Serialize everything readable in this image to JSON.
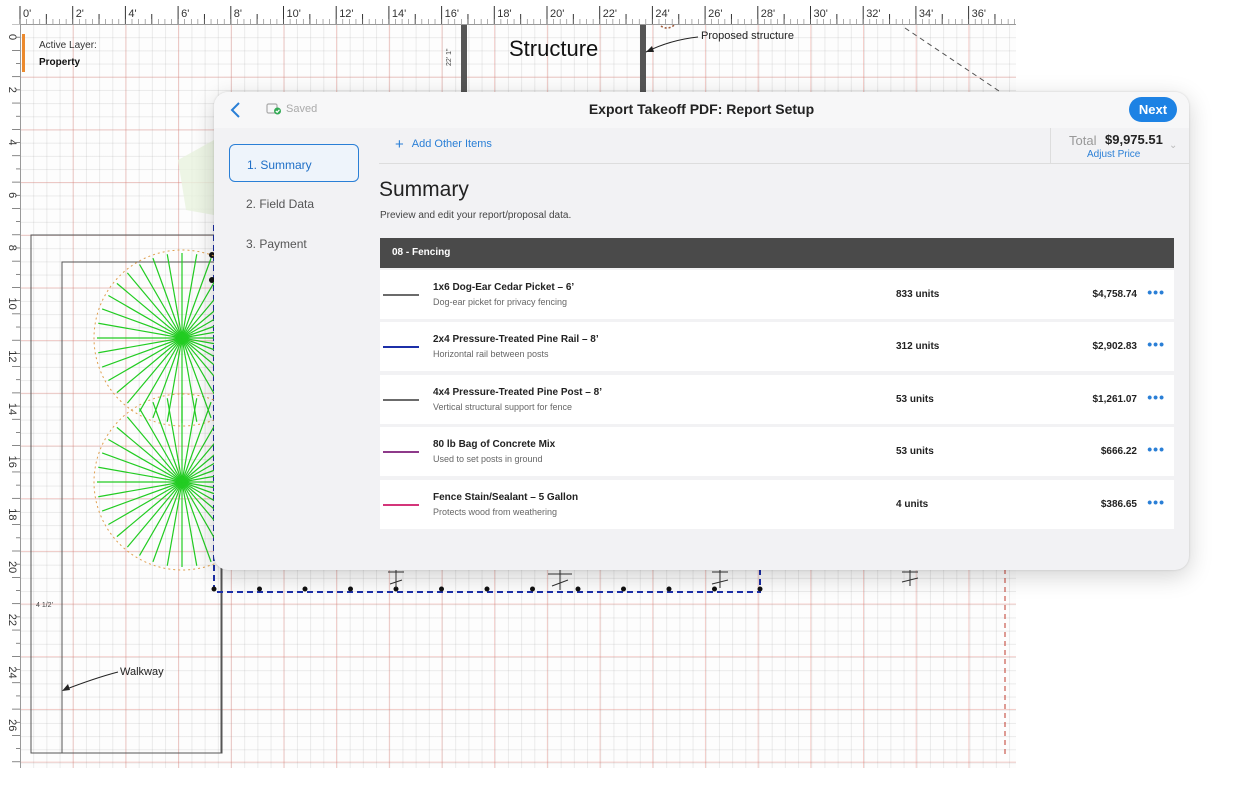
{
  "ruler": {
    "top_labels": [
      "0'",
      "2'",
      "4'",
      "6'",
      "8'",
      "10'",
      "12'",
      "14'",
      "16'",
      "18'",
      "20'",
      "22'",
      "24'",
      "26'",
      "28'",
      "30'",
      "32'",
      "34'",
      "36'"
    ],
    "left_labels": [
      "0",
      "2",
      "4",
      "6",
      "8",
      "10",
      "12",
      "14",
      "16",
      "18",
      "20",
      "22",
      "24",
      "26"
    ]
  },
  "layer": {
    "label": "Active Layer:",
    "value": "Property"
  },
  "canvas": {
    "structure_label": "Structure",
    "proposed_label": "Proposed structure",
    "walkway_label": "Walkway",
    "dimension_label": "4 1/2'"
  },
  "header": {
    "title": "Export Takeoff PDF: Report Setup",
    "saved": "Saved",
    "next": "Next"
  },
  "steps": [
    {
      "label": "1. Summary",
      "active": true
    },
    {
      "label": "2. Field Data",
      "active": false
    },
    {
      "label": "3. Payment",
      "active": false
    }
  ],
  "toolbar": {
    "add_other": "Add Other Items",
    "total_label": "Total",
    "total_value": "$9,975.51",
    "adjust_price": "Adjust Price"
  },
  "summary": {
    "heading": "Summary",
    "subtitle": "Preview and edit your report/proposal data.",
    "section": "08 - Fencing",
    "items": [
      {
        "name": "1x6 Dog-Ear Cedar Picket – 6’",
        "desc": "Dog-ear picket for privacy fencing",
        "qty": "833 units",
        "price": "$4,758.74",
        "color": "#6b6b6b"
      },
      {
        "name": "2x4 Pressure-Treated Pine Rail – 8’",
        "desc": "Horizontal rail between posts",
        "qty": "312 units",
        "price": "$2,902.83",
        "color": "#1c2fa8"
      },
      {
        "name": "4x4 Pressure-Treated Pine Post – 8’",
        "desc": "Vertical structural support for fence",
        "qty": "53 units",
        "price": "$1,261.07",
        "color": "#6b6b6b"
      },
      {
        "name": "80 lb Bag of Concrete Mix",
        "desc": "Used to set posts in ground",
        "qty": "53 units",
        "price": "$666.22",
        "color": "#8e3a8a"
      },
      {
        "name": "Fence Stain/Sealant – 5 Gallon",
        "desc": "Protects wood from weathering",
        "qty": "4 units",
        "price": "$386.65",
        "color": "#d4357a"
      }
    ],
    "more_glyph": "•••"
  }
}
